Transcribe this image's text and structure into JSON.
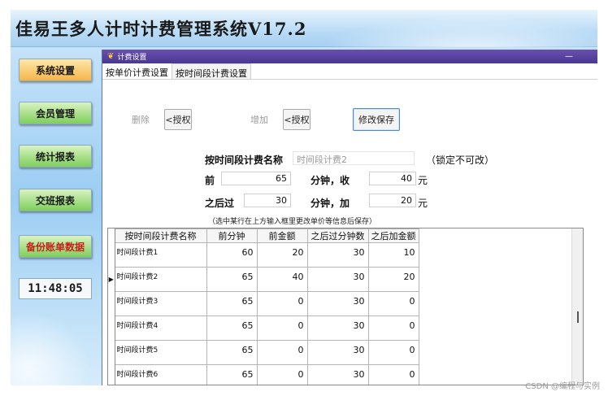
{
  "app": {
    "title": "佳易王多人计时计费管理系统V17.2"
  },
  "sidebar": {
    "items": [
      {
        "label": "系统设置"
      },
      {
        "label": "会员管理"
      },
      {
        "label": "统计报表"
      },
      {
        "label": "交班报表"
      },
      {
        "label": "备份账单数据"
      }
    ],
    "clock": "11:48:05"
  },
  "window": {
    "title": "计费设置",
    "min_glyph": "—",
    "tabs": [
      {
        "label": "按单价计费设置"
      },
      {
        "label": "按时间段计费设置"
      }
    ]
  },
  "toolbar": {
    "delete_label": "删除",
    "auth_label": "<授权",
    "add_label": "增加",
    "auth2_label": "<授权",
    "save_label": "修改保存"
  },
  "form": {
    "name_label": "按时间段计费名称",
    "name_value": "时间段计费2",
    "locked_note": "（锁定不可改）",
    "before_label": "前",
    "before_minutes": "65",
    "minutes_charge_label": "分钟，收",
    "charge_amount": "40",
    "yuan1": "元",
    "after_label": "之后过",
    "after_minutes": "30",
    "minutes_add_label": "分钟，加",
    "add_amount": "20",
    "yuan2": "元",
    "hint": "（选中某行在上方输入框里更改单价等信息后保存）"
  },
  "table": {
    "columns": [
      "按时间段计费名称",
      "前分钟",
      "前金额",
      "之后过分钟数",
      "之后加金额"
    ],
    "rows": [
      [
        "时间段计费1",
        "60",
        "20",
        "30",
        "10"
      ],
      [
        "时间段计费2",
        "65",
        "40",
        "30",
        "20"
      ],
      [
        "时间段计费3",
        "65",
        "0",
        "30",
        "0"
      ],
      [
        "时间段计费4",
        "65",
        "0",
        "30",
        "0"
      ],
      [
        "时间段计费5",
        "65",
        "0",
        "30",
        "0"
      ],
      [
        "时间段计费6",
        "65",
        "0",
        "30",
        "0"
      ]
    ],
    "selected_row_marker": "▶"
  },
  "watermark": "CSDN @编程与实例",
  "colors": {
    "titlebar": "#5a40a0",
    "selected_button": "#f5b54a",
    "green_button": "#7fcf5b",
    "backup_text": "#c81e1e"
  }
}
